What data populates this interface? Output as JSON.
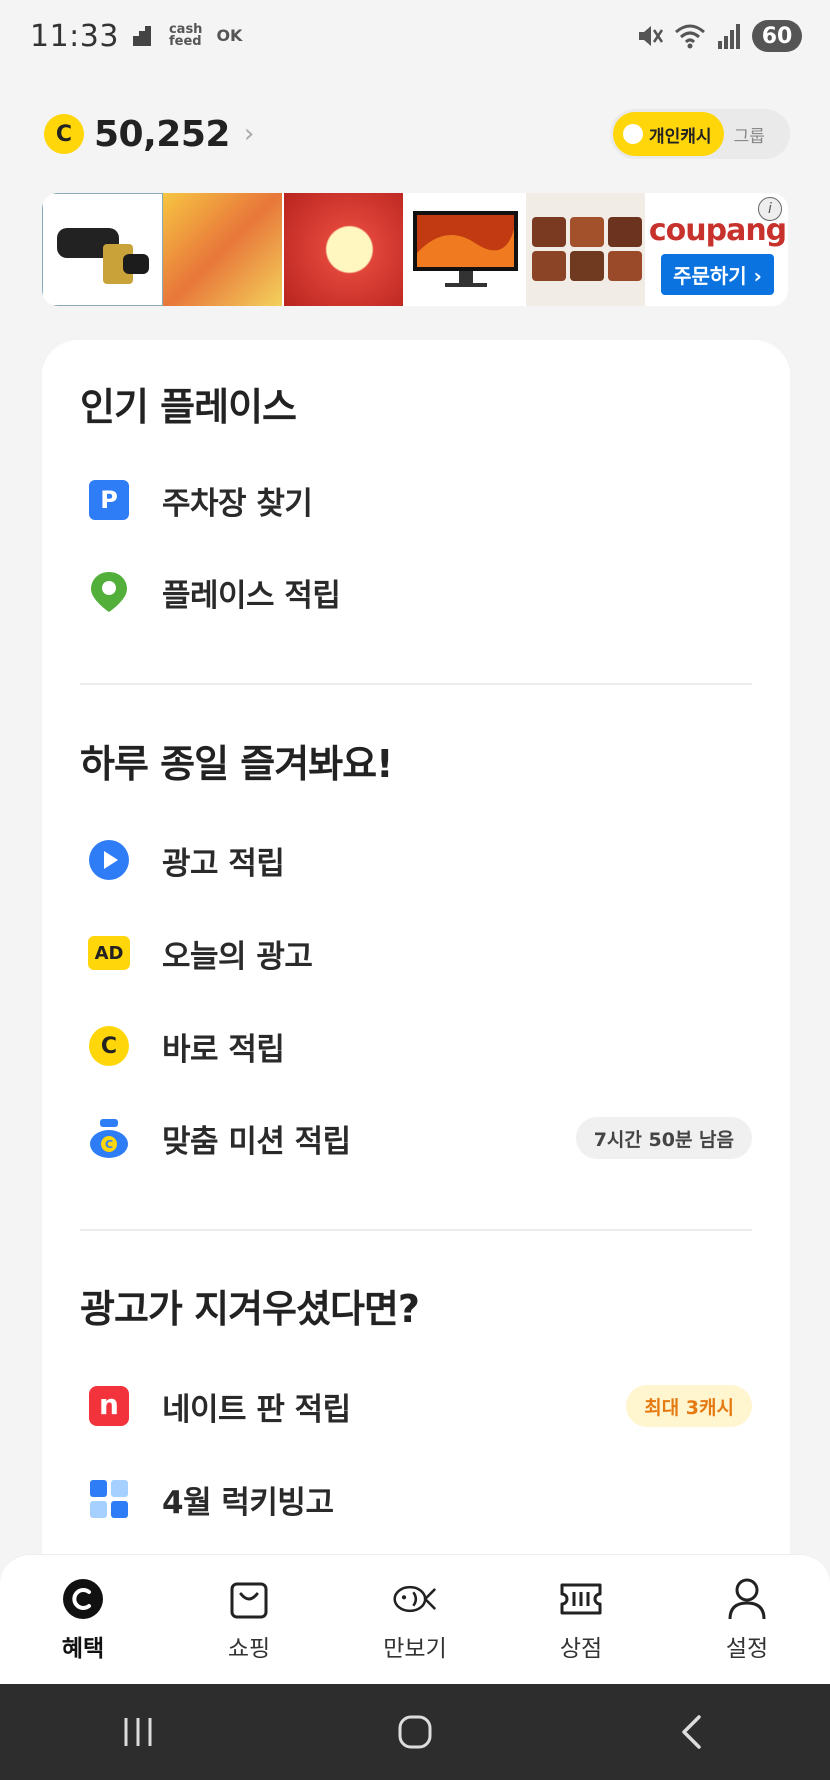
{
  "status_bar": {
    "time": "11:33",
    "mini_label_1": "cash\nfeed",
    "mini_label_2": "OK",
    "battery": "60"
  },
  "header": {
    "coin_symbol": "C",
    "cash_amount": "50,252",
    "toggle": {
      "active_label": "개인캐시",
      "inactive_label": "그룹"
    }
  },
  "ad_banner": {
    "brand": "coupang",
    "cta": "주문하기 ›",
    "info": "i"
  },
  "sections": [
    {
      "title": "인기 플레이스",
      "items": [
        {
          "label": "주차장 찾기",
          "icon": "parking-icon"
        },
        {
          "label": "플레이스 적립",
          "icon": "location-pin-icon"
        }
      ]
    },
    {
      "title": "하루 종일 즐겨봐요!",
      "items": [
        {
          "label": "광고 적립",
          "icon": "play-icon"
        },
        {
          "label": "오늘의 광고",
          "icon": "ad-icon"
        },
        {
          "label": "바로 적립",
          "icon": "coin-icon"
        },
        {
          "label": "맞춤 미션 적립",
          "icon": "coin-pouch-icon",
          "badge": "7시간 50분 남음"
        }
      ]
    },
    {
      "title": "광고가 지겨우셨다면?",
      "items": [
        {
          "label": "네이트 판 적립",
          "icon": "nate-icon",
          "badge": "최대 3캐시"
        },
        {
          "label": "4월 럭키빙고",
          "icon": "bingo-icon"
        }
      ]
    }
  ],
  "icon_text": {
    "parking": "P",
    "ad": "AD",
    "coin": "C",
    "nate": "n"
  },
  "bottom_nav": [
    {
      "label": "혜택",
      "icon": "benefit-coin-icon",
      "active": true
    },
    {
      "label": "쇼핑",
      "icon": "shopping-bag-icon",
      "active": false
    },
    {
      "label": "만보기",
      "icon": "fish-pedometer-icon",
      "active": false
    },
    {
      "label": "상점",
      "icon": "ticket-store-icon",
      "active": false
    },
    {
      "label": "설정",
      "icon": "person-settings-icon",
      "active": false
    }
  ],
  "colors": {
    "accent_yellow": "#ffd60a",
    "background": "#f4f4f4",
    "coupang_red": "#c8322c",
    "coupang_blue": "#0a73e0",
    "badge_orange": "#e57a13"
  }
}
